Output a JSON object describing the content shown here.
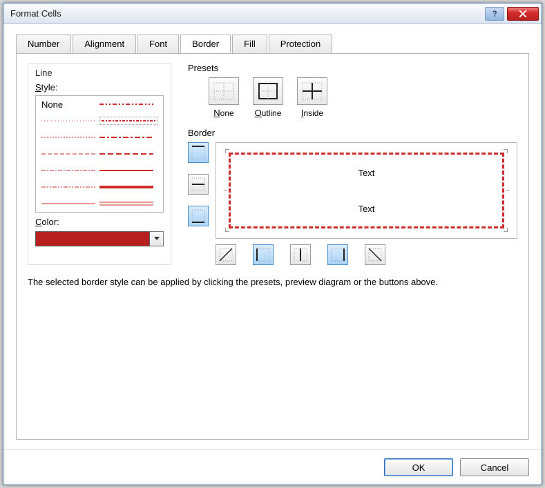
{
  "title": "Format Cells",
  "tabs": [
    "Number",
    "Alignment",
    "Font",
    "Border",
    "Fill",
    "Protection"
  ],
  "active_tab_index": 3,
  "line": {
    "group_label": "Line",
    "style_label": "Style:",
    "none_label": "None",
    "color_label": "Color:",
    "color_value": "#B81F1F"
  },
  "presets": {
    "label": "Presets",
    "items": [
      {
        "key": "none",
        "label": "None"
      },
      {
        "key": "outline",
        "label": "Outline"
      },
      {
        "key": "inside",
        "label": "Inside"
      }
    ]
  },
  "border": {
    "label": "Border",
    "preview_text_top": "Text",
    "preview_text_bottom": "Text"
  },
  "hint": "The selected border style can be applied by clicking the presets, preview diagram or the buttons above.",
  "buttons": {
    "ok": "OK",
    "cancel": "Cancel"
  },
  "colors": {
    "border_color": "#CF2A2A"
  }
}
